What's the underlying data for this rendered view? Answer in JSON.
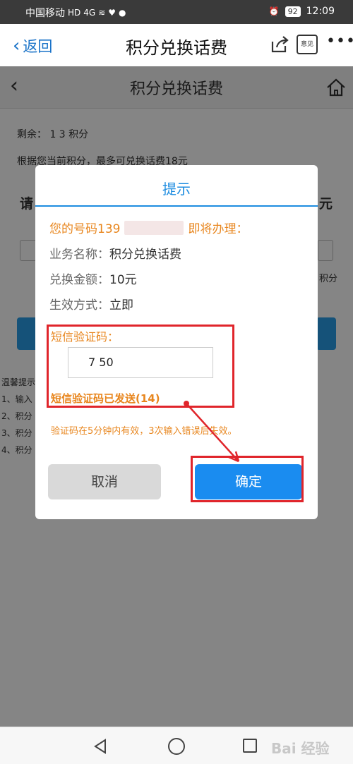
{
  "status_bar": {
    "carrier": "中国移动",
    "hd_badge": "HD",
    "signal": "4G",
    "battery": "92",
    "time": "12:09"
  },
  "app_bar": {
    "back_label": "返回",
    "title": "积分兑换话费",
    "feedback_label": "意见"
  },
  "page": {
    "title": "积分兑换话费",
    "remain": "剩余： 1  3 积分",
    "hint": "根据您当前积分，最多可兑换话费18元",
    "request_partial": "请",
    "yuan_partial": "元",
    "jifen_partial": "积分",
    "tips": [
      "温馨提示",
      "1、输入",
      "2、积分",
      "3、积分",
      "4、积分"
    ]
  },
  "dialog": {
    "title": "提示",
    "number_prefix": "您的号码139",
    "number_suffix": "即将办理：",
    "rows": [
      {
        "label": "业务名称：",
        "value": "积分兑换话费"
      },
      {
        "label": "兑换金额：",
        "value": "10元"
      },
      {
        "label": "生效方式：",
        "value": "立即"
      }
    ],
    "sms_label": "短信验证码：",
    "sms_value": "7    50",
    "sms_sent": "短信验证码已发送(14)",
    "sms_note": "验证码在5分钟内有效，3次输入错误后失效。",
    "cancel_label": "取消",
    "ok_label": "确定"
  },
  "navbar": {
    "watermark": "Bai 经验"
  },
  "colors": {
    "accent_blue": "#1d8ce0",
    "orange": "#e8861e",
    "annotation_red": "#e0252b"
  }
}
